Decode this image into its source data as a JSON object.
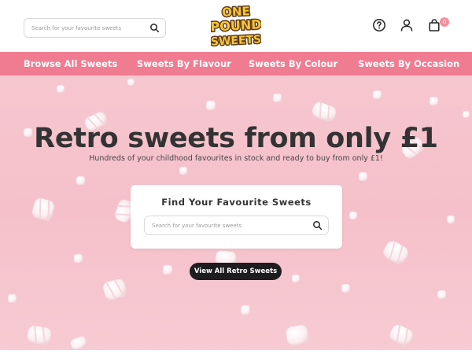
{
  "header": {
    "search": {
      "placeholder": "Search for your favourite sweets",
      "button_icon": "search-icon"
    },
    "logo": {
      "line1": "ONE",
      "line2": "POUND",
      "line3": "SWEETS"
    },
    "icons": {
      "help": "help-circle-icon",
      "account": "user-icon",
      "basket": "shopping-bag-icon"
    },
    "basket_count": "0"
  },
  "nav": {
    "items": [
      {
        "label": "Browse All Sweets"
      },
      {
        "label": "Sweets By Flavour"
      },
      {
        "label": "Sweets By Colour"
      },
      {
        "label": "Sweets By Occasion"
      }
    ]
  },
  "hero": {
    "title": "Retro sweets from only £1",
    "subtitle": "Hundreds of your childhood favourites in stock and ready to buy from only £1!",
    "finder": {
      "title": "Find Your Favourite Sweets",
      "placeholder": "Search for your favourite sweets"
    },
    "cta_label": "View All Retro Sweets"
  },
  "colors": {
    "nav_bg": "#f07c92",
    "hero_bg": "#f5c0ca",
    "badge": "#f2909f",
    "cta_bg": "#1d1d1f",
    "logo_yellow": "#f9c532",
    "logo_outline": "#5b3a1e"
  }
}
